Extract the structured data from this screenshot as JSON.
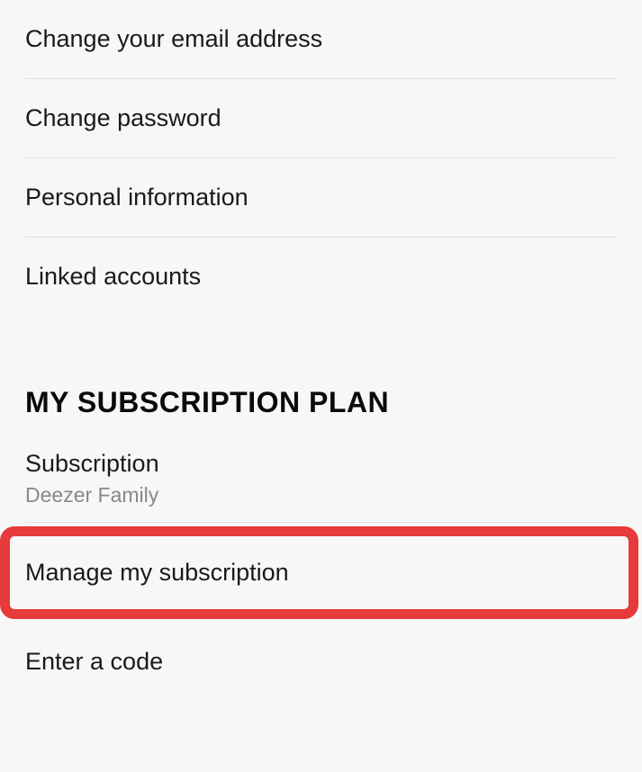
{
  "account": {
    "items": [
      {
        "label": "Change your email address"
      },
      {
        "label": "Change password"
      },
      {
        "label": "Personal information"
      },
      {
        "label": "Linked accounts"
      }
    ]
  },
  "subscription": {
    "header": "MY SUBSCRIPTION PLAN",
    "label": "Subscription",
    "plan": "Deezer Family",
    "manage_label": "Manage my subscription",
    "code_label": "Enter a code"
  }
}
